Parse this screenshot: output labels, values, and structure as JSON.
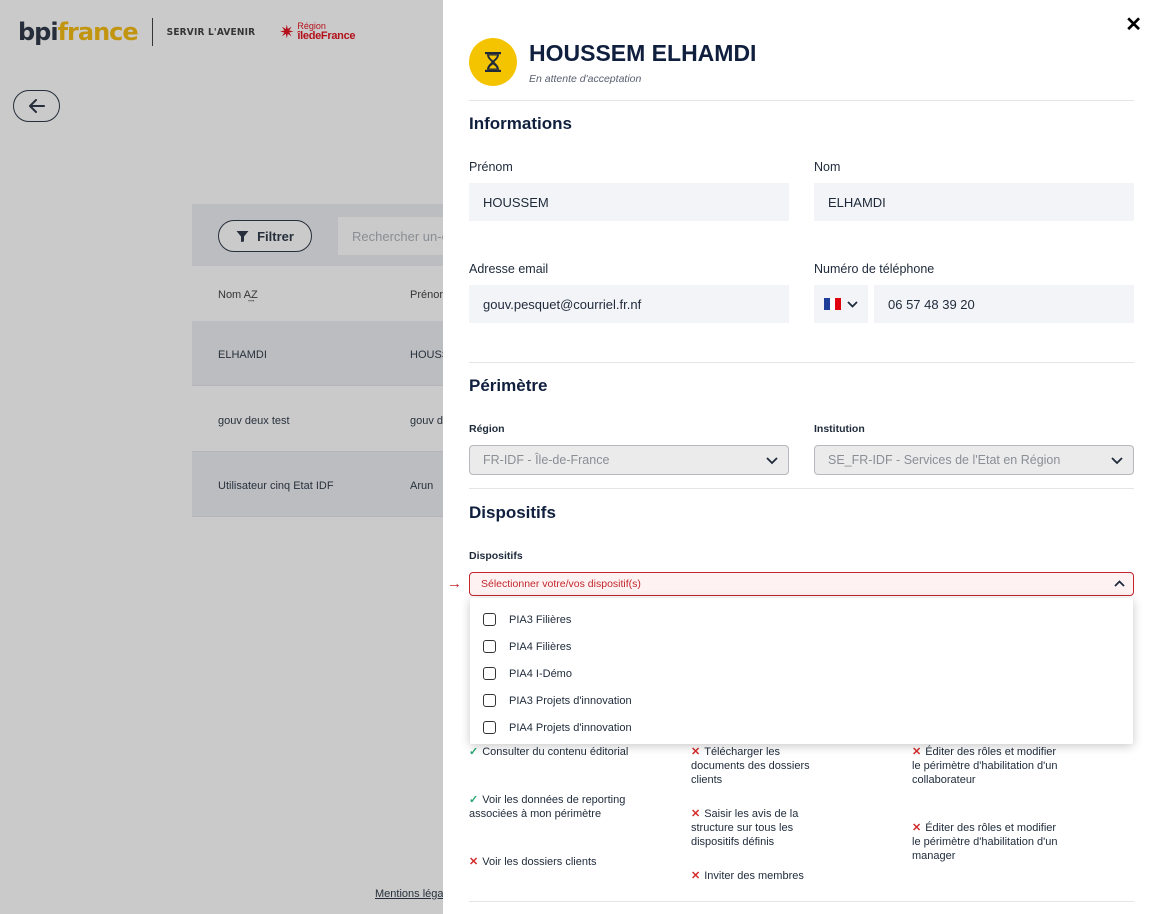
{
  "background": {
    "brand": {
      "logo_bpi": "bpi",
      "logo_france": "france",
      "tagline": "SERVIR L'AVENIR",
      "region_line1": "Région",
      "region_line2": "îledeFrance"
    },
    "search_placeholder": "Rechercher un-e",
    "filter_label": "Filtrer",
    "columns": {
      "nom": "Nom A͢Z",
      "prenom": "Prénor"
    },
    "rows": [
      {
        "nom": "ELHAMDI",
        "prenom": "HOUSS"
      },
      {
        "nom": "gouv deux test",
        "prenom": "gouv d"
      },
      {
        "nom": "Utilisateur cinq Etat IDF",
        "prenom": "Arun"
      }
    ],
    "mentions": "Mentions léga"
  },
  "drawer": {
    "close_label": "✕",
    "avatar_icon": "hourglass-icon",
    "user_name": "HOUSSEM ELHAMDI",
    "user_status": "En attente d'acceptation",
    "informations": {
      "title": "Informations",
      "prenom_label": "Prénom",
      "prenom_value": "HOUSSEM",
      "nom_label": "Nom",
      "nom_value": "ELHAMDI",
      "email_label": "Adresse email",
      "email_value": "gouv.pesquet@courriel.fr.nf",
      "phone_label": "Numéro de téléphone",
      "phone_value": "06 57 48 39 20",
      "country_flag": "fr-flag-icon"
    },
    "perimetre": {
      "title": "Périmètre",
      "region_label": "Région",
      "region_value": "FR-IDF - Île-de-France",
      "institution_label": "Institution",
      "institution_value": "SE_FR-IDF - Services de l'Etat en Région"
    },
    "dispositifs": {
      "title": "Dispositifs",
      "field_label": "Dispositifs",
      "placeholder": "Sélectionner votre/vos dispositif(s)",
      "options": [
        "PIA3 Filières",
        "PIA4 Filières",
        "PIA4 I-Démo",
        "PIA3 Projets d'innovation",
        "PIA4 Projets d'innovation"
      ]
    },
    "permissions": {
      "col1": [
        {
          "ok": true,
          "text": "Consulter du contenu éditorial"
        },
        {
          "ok": true,
          "text": "Voir les données de reporting associées à mon périmètre"
        },
        {
          "ok": false,
          "text": "Voir les dossiers clients"
        }
      ],
      "col2": [
        {
          "ok": false,
          "text": "Télécharger les documents des dossiers clients"
        },
        {
          "ok": false,
          "text": "Saisir les avis de la structure sur tous les dispositifs définis"
        },
        {
          "ok": false,
          "text": "Inviter des membres"
        }
      ],
      "col3": [
        {
          "ok": false,
          "text": "Éditer des rôles et modifier le périmètre d'habilitation d'un collaborateur"
        },
        {
          "ok": false,
          "text": "Éditer des rôles et modifier le périmètre d'habilitation d'un manager"
        }
      ]
    },
    "colors": {
      "accent": "#0f1f3d",
      "avatar_bg": "#f5c400",
      "error": "#c1272d",
      "ok": "#2aa56f",
      "ko": "#d42b2b"
    }
  }
}
